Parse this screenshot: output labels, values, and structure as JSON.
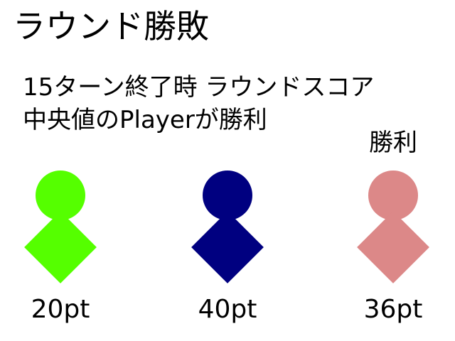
{
  "title": "ラウンド勝敗",
  "rule_lines": [
    "15ターン終了時 ラウンドスコア",
    "中央値のPlayerが勝利"
  ],
  "winner_label": "勝利",
  "players": [
    {
      "color": "#55ff00",
      "score": "20pt",
      "is_winner": false
    },
    {
      "color": "#000080",
      "score": "40pt",
      "is_winner": false
    },
    {
      "color": "#dc8888",
      "score": "36pt",
      "is_winner": true
    }
  ]
}
